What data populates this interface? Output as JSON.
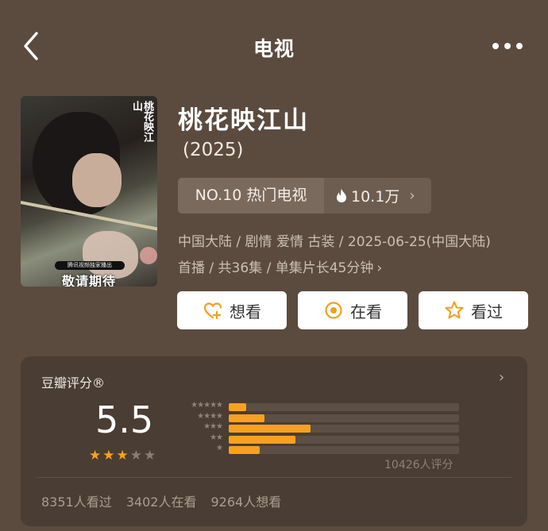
{
  "nav": {
    "title": "电视",
    "back_icon": "chevron-left-icon",
    "more_icon": "ellipsis-icon"
  },
  "poster": {
    "logo_text": "桃花映江山",
    "badge_text": "腾讯视频独家播出",
    "caption": "敬请期待"
  },
  "show": {
    "title": "桃花映江山",
    "year": "(2025)",
    "rank_label": "NO.10 热门电视",
    "heat_value": "10.1万",
    "meta_line1": "中国大陆 / 剧情 爱情 古装 / 2025-06-25(中国大陆)",
    "meta_line2": "首播 / 共36集 / 单集片长45分钟"
  },
  "actions": [
    {
      "label": "想看",
      "icon": "heart-plus-icon"
    },
    {
      "label": "在看",
      "icon": "circle-dot-icon"
    },
    {
      "label": "看过",
      "icon": "star-outline-icon"
    }
  ],
  "rating": {
    "title": "豆瓣评分®",
    "score": "5.5",
    "stars_filled": 3,
    "stars_total": 5,
    "distribution": [
      {
        "stars": 5,
        "percent": 7.5
      },
      {
        "stars": 4,
        "percent": 15.5
      },
      {
        "stars": 3,
        "percent": 35.5
      },
      {
        "stars": 2,
        "percent": 29
      },
      {
        "stars": 1,
        "percent": 13.5
      }
    ],
    "raters": "10426人评分",
    "watched": "8351人看过",
    "watching": "3402人在看",
    "wish": "9264人想看"
  },
  "colors": {
    "background": "#5b4b3f",
    "card": "#4a3d33",
    "accent": "#f6a120",
    "button_icon": "#f0a020"
  }
}
